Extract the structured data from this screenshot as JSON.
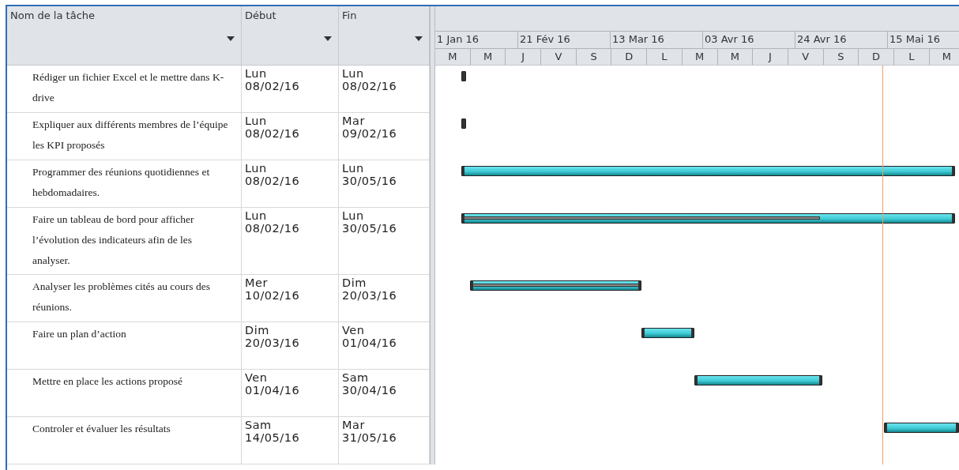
{
  "columns": [
    {
      "label": "Nom de la tâche"
    },
    {
      "label": "Début"
    },
    {
      "label": "Fin"
    }
  ],
  "timescale": {
    "major": [
      "1 Jan 16",
      "21 Fév 16",
      "13 Mar 16",
      "03 Avr 16",
      "24 Avr 16",
      "15 Mai 16"
    ],
    "minor": [
      "M",
      "M",
      "J",
      "V",
      "S",
      "D",
      "L",
      "M",
      "M",
      "J",
      "V",
      "S",
      "D",
      "L",
      "M"
    ]
  },
  "tasks": [
    {
      "name": "Rédiger un fichier Excel et le mettre dans K-drive",
      "start": "Lun 08/02/16",
      "end": "Lun 08/02/16"
    },
    {
      "name": "Expliquer aux différents membres de l’équipe les KPI proposés",
      "start": "Lun 08/02/16",
      "end": "Mar 09/02/16"
    },
    {
      "name": "Programmer des réunions quotidiennes et hebdomadaires.",
      "start": "Lun 08/02/16",
      "end": "Lun 30/05/16"
    },
    {
      "name": "Faire un tableau de bord pour afficher l’évolution des indicateurs afin de les analyser.",
      "start": "Lun 08/02/16",
      "end": "Lun 30/05/16",
      "progress": {
        "level": 0.73
      }
    },
    {
      "name": "Analyser les problèmes cités au cours des réunions.",
      "start": "Mer 10/02/16",
      "end": "Dim 20/03/16",
      "progress": {
        "level": 1
      }
    },
    {
      "name": "Faire un plan d’action",
      "start": "Dim 20/03/16",
      "end": "Ven 01/04/16"
    },
    {
      "name": "Mettre en place les actions proposé",
      "start": "Ven 01/04/16",
      "end": "Sam 30/04/16"
    },
    {
      "name": "Controler et évaluer les résultats",
      "start": "Sam 14/05/16",
      "end": "Mar 31/05/16"
    }
  ],
  "today_line": {
    "level": 0.853
  }
}
